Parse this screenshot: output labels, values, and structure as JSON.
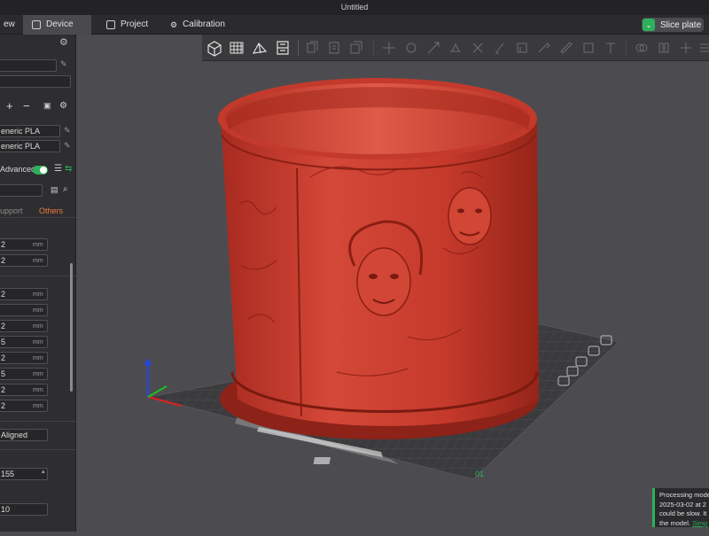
{
  "window": {
    "title": "Untitled"
  },
  "tabs": [
    {
      "label": "ew",
      "icon": "prepare-icon"
    },
    {
      "label": "Device",
      "icon": "device-icon"
    },
    {
      "label": "Project",
      "icon": "project-icon"
    },
    {
      "label": "Calibration",
      "icon": "calibration-icon"
    }
  ],
  "actions": {
    "slice_label": "Slice plate"
  },
  "sidebar": {
    "filament1": "eneric PLA",
    "filament2": "eneric PLA",
    "advanced_label": "Advanced",
    "tab_support": "upport",
    "tab_others": "Others",
    "unit": "mm",
    "values": [
      "2",
      "2",
      "2",
      "",
      "2",
      "5",
      "2",
      "5",
      "2",
      "2"
    ],
    "seam_value": "Aligned",
    "number_value": "155",
    "bottom_value": "10"
  },
  "plate": {
    "number": "01"
  },
  "toast": {
    "line1": "Processing mode",
    "line2": "2025-03-02 at 2",
    "line3": "could be slow. It",
    "line4": "the model.",
    "link": "Simp"
  },
  "colors": {
    "model": "#c83a2c",
    "accent": "#2db05a",
    "bed": "#3a3a3c"
  }
}
